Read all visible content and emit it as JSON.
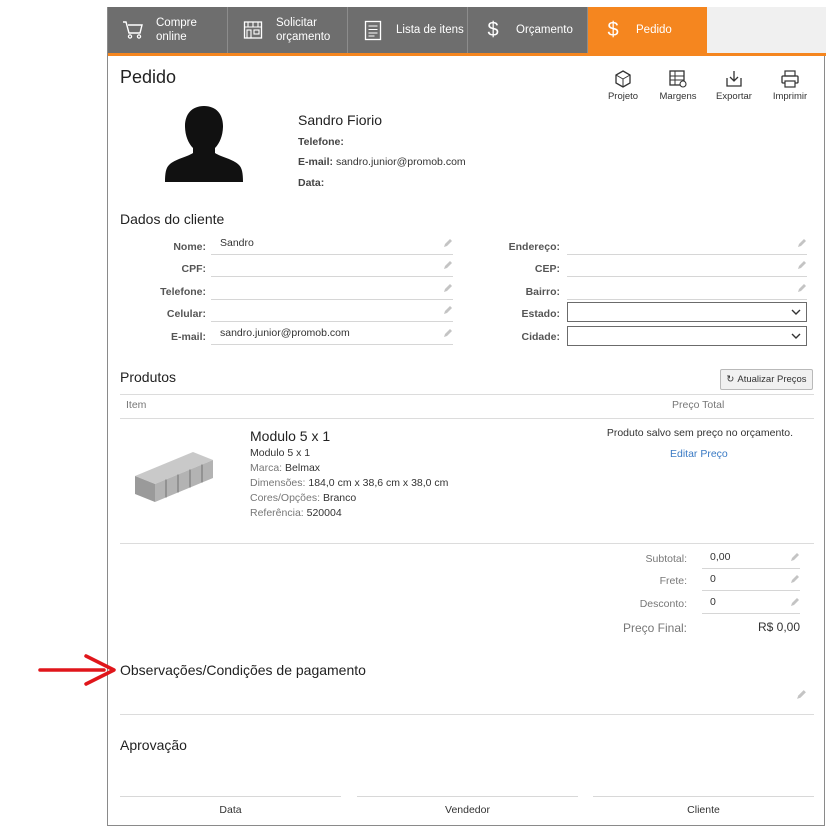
{
  "tabs": [
    {
      "label": "Compre\nonline",
      "icon": "cart-icon"
    },
    {
      "label": "Solicitar\norçamento",
      "icon": "store-icon"
    },
    {
      "label": "Lista de itens",
      "icon": "list-icon"
    },
    {
      "label": "Orçamento",
      "icon": "dollar-icon"
    },
    {
      "label": "Pedido",
      "icon": "dollar-icon",
      "active": true
    }
  ],
  "page": {
    "title": "Pedido"
  },
  "toolbar": [
    {
      "label": "Projeto",
      "icon": "cube-icon"
    },
    {
      "label": "Margens",
      "icon": "margin-table-icon"
    },
    {
      "label": "Exportar",
      "icon": "export-icon"
    },
    {
      "label": "Imprimir",
      "icon": "printer-icon"
    }
  ],
  "customer": {
    "name": "Sandro Fiorio",
    "phone_label": "Telefone:",
    "phone_value": "",
    "email_label": "E-mail:",
    "email_value": "sandro.junior@promob.com",
    "date_label": "Data:",
    "date_value": ""
  },
  "client_data": {
    "title": "Dados do cliente",
    "left_fields": [
      {
        "label": "Nome:",
        "value": "Sandro"
      },
      {
        "label": "CPF:",
        "value": ""
      },
      {
        "label": "Telefone:",
        "value": ""
      },
      {
        "label": "Celular:",
        "value": ""
      },
      {
        "label": "E-mail:",
        "value": "sandro.junior@promob.com"
      }
    ],
    "right_fields": [
      {
        "label": "Endereço:",
        "value": ""
      },
      {
        "label": "CEP:",
        "value": ""
      },
      {
        "label": "Bairro:",
        "value": ""
      },
      {
        "label": "Estado:",
        "value": ""
      },
      {
        "label": "Cidade:",
        "value": ""
      }
    ]
  },
  "products": {
    "title": "Produtos",
    "refresh_label": "Atualizar Preços",
    "col_item": "Item",
    "col_total": "Preço Total",
    "item": {
      "name": "Modulo 5 x 1",
      "subtitle": "Modulo 5 x 1",
      "brand_key": "Marca:",
      "brand": "Belmax",
      "dims_key": "Dimensões:",
      "dims": "184,0 cm x 38,6 cm x 38,0 cm",
      "options_key": "Cores/Opções:",
      "options": "Branco",
      "ref_key": "Referência:",
      "ref": "520004",
      "note": "Produto salvo sem preço no orçamento.",
      "edit_price": "Editar Preço"
    }
  },
  "totals": {
    "subtotal_label": "Subtotal:",
    "subtotal_value": "0,00",
    "freight_label": "Frete:",
    "freight_value": "0",
    "discount_label": "Desconto:",
    "discount_value": "0",
    "final_label": "Preço Final:",
    "final_value": "R$ 0,00"
  },
  "observations": {
    "title": "Observações/Condições de pagamento"
  },
  "approval": {
    "title": "Aprovação",
    "data_label": "Data",
    "seller_label": "Vendedor",
    "client_label": "Cliente"
  },
  "colors": {
    "accent": "#f5861f",
    "tab_bg": "#6e6e6e",
    "link": "#3a7ac4",
    "arrow": "#e0161b"
  }
}
